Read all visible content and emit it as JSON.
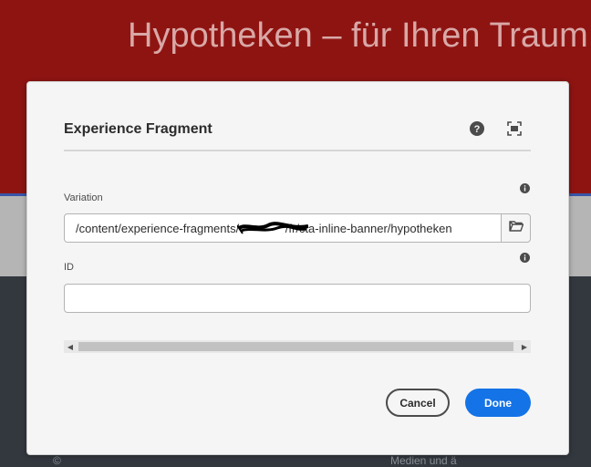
{
  "page": {
    "hero_title": "Hypotheken – für Ihren Traum",
    "bottom_left": "©",
    "bottom_right": "Medien und ä"
  },
  "dialog": {
    "title": "Experience Fragment",
    "help_icon": "help-circle-icon",
    "fullscreen_icon": "fullscreen-icon",
    "variation": {
      "label": "Variation",
      "value": "/content/experience-fragments/              /fr/cta-inline-banner/hypotheken",
      "browse_icon": "folder-icon",
      "info_icon": "info-icon"
    },
    "id_field": {
      "label": "ID",
      "value": "",
      "info_icon": "info-icon"
    },
    "buttons": {
      "cancel": "Cancel",
      "done": "Done"
    }
  },
  "colors": {
    "hero_red": "#8e1412",
    "primary_blue": "#1473e6",
    "dark_background": "#33383f"
  }
}
